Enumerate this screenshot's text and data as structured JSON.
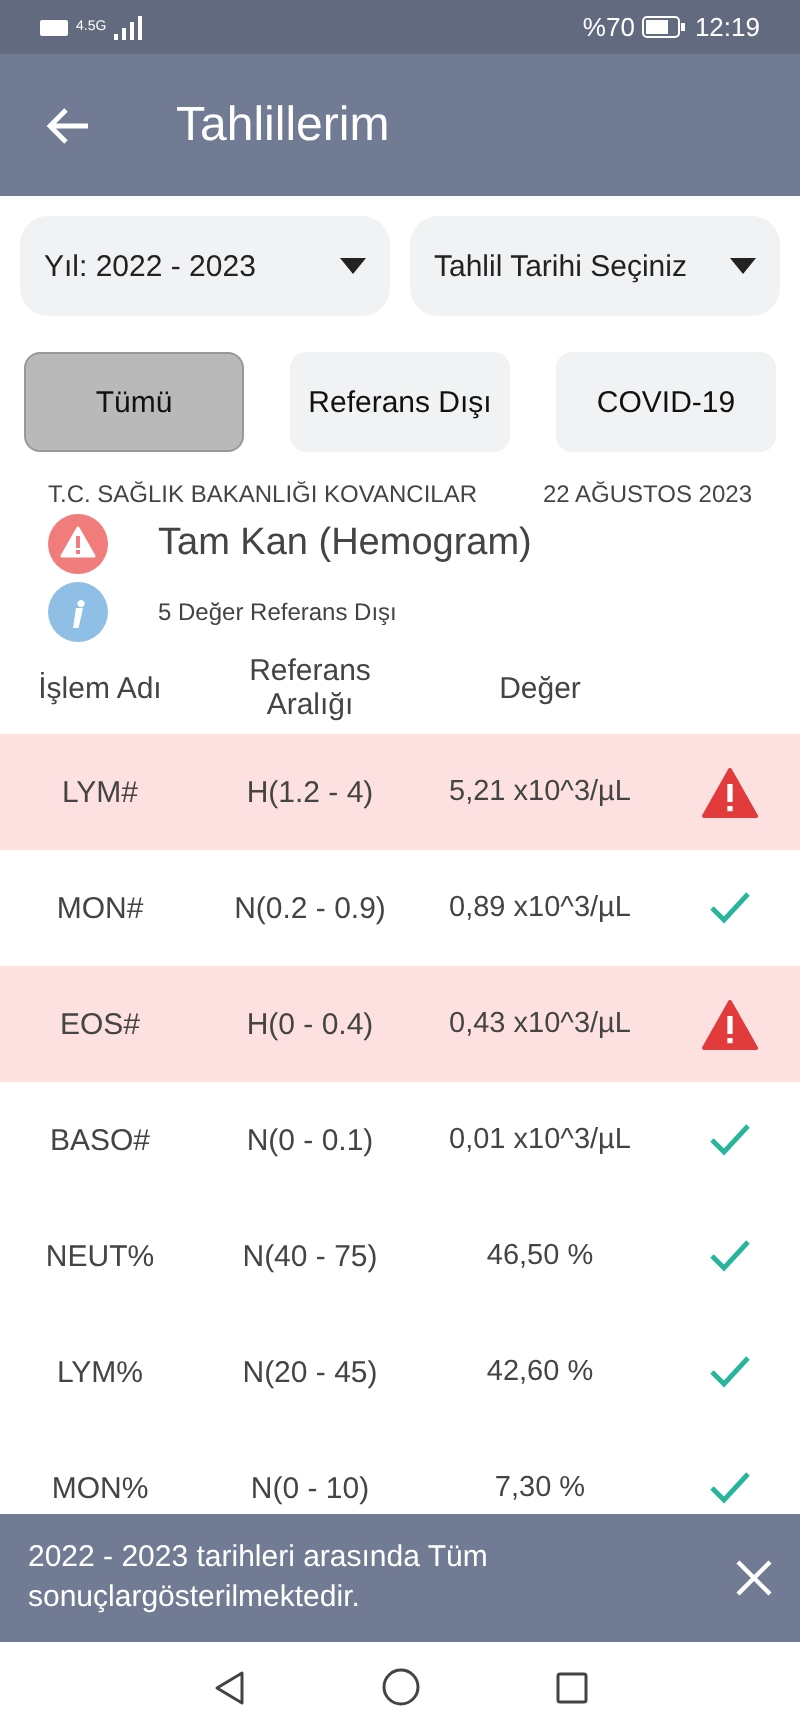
{
  "status_bar": {
    "network": "4.5G",
    "battery_text": "%70",
    "time": "12:19"
  },
  "header": {
    "title": "Tahlillerim"
  },
  "dropdowns": [
    {
      "label": "Yıl: 2022 - 2023"
    },
    {
      "label": "Tahlil Tarihi Seçiniz"
    }
  ],
  "filters": [
    {
      "label": "Tümü",
      "selected": true
    },
    {
      "label": "Referans Dışı",
      "selected": false
    },
    {
      "label": "COVID-19",
      "selected": false
    }
  ],
  "result": {
    "institution": "T.C. SAĞLIK BAKANLIĞI KOVANCILAR",
    "date": "22 AĞUSTOS 2023",
    "test_name": "Tam Kan (Hemogram)",
    "summary": "5 Değer Referans Dışı"
  },
  "table": {
    "columns": [
      "İşlem Adı",
      "Referans Aralığı",
      "Değer"
    ],
    "rows": [
      {
        "name": "LYM#",
        "reference": "H(1.2 - 4)",
        "value": "5,21 x10^3/µL",
        "out_of_range": true
      },
      {
        "name": "MON#",
        "reference": "N(0.2 - 0.9)",
        "value": "0,89 x10^3/µL",
        "out_of_range": false
      },
      {
        "name": "EOS#",
        "reference": "H(0 - 0.4)",
        "value": "0,43 x10^3/µL",
        "out_of_range": true
      },
      {
        "name": "BASO#",
        "reference": "N(0 - 0.1)",
        "value": "0,01 x10^3/µL",
        "out_of_range": false
      },
      {
        "name": "NEUT%",
        "reference": "N(40 - 75)",
        "value": "46,50 %",
        "out_of_range": false
      },
      {
        "name": "LYM%",
        "reference": "N(20 - 45)",
        "value": "42,60 %",
        "out_of_range": false
      },
      {
        "name": "MON%",
        "reference": "N(0 - 10)",
        "value": "7,30 %",
        "out_of_range": false
      }
    ]
  },
  "snackbar": {
    "message": "2022 - 2023 tarihleri arasında Tüm sonuçlargösterilmektedir."
  }
}
